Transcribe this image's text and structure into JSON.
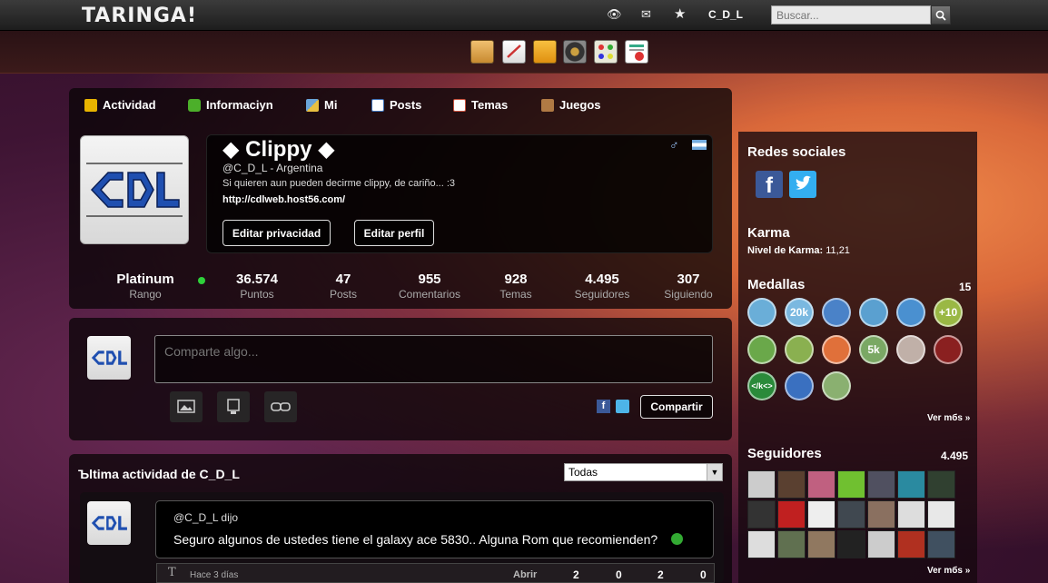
{
  "topbar": {
    "logo": "TARINGA!",
    "username": "C_D_L",
    "search_placeholder": "Buscar..."
  },
  "tabs": [
    {
      "label": "Actividad",
      "icon": "actividad-icon",
      "color": "#e8b400"
    },
    {
      "label": "Informaciyn",
      "icon": "info-icon",
      "color": "#4caf2a"
    },
    {
      "label": "Mi",
      "icon": "mi-icon",
      "color": "#6aa4d8"
    },
    {
      "label": "Posts",
      "icon": "posts-icon",
      "color": "#3b6fb6"
    },
    {
      "label": "Temas",
      "icon": "temas-icon",
      "color": "#c8503c"
    },
    {
      "label": "Juegos",
      "icon": "juegos-icon",
      "color": "#b07a44"
    }
  ],
  "profile": {
    "name": "◆ Clippy ◆",
    "handle": "@C_D_L - Argentina",
    "bio": "Si quieren aun pueden decirme clippy, de cariño... :3",
    "url": "http://cdlweb.host56.com/",
    "edit_privacy": "Editar privacidad",
    "edit_profile": "Editar perfil"
  },
  "stats": [
    {
      "value": "Platinum",
      "label": "Rango"
    },
    {
      "value": "36.574",
      "label": "Puntos"
    },
    {
      "value": "47",
      "label": "Posts"
    },
    {
      "value": "955",
      "label": "Comentarios"
    },
    {
      "value": "928",
      "label": "Temas"
    },
    {
      "value": "4.495",
      "label": "Seguidores"
    },
    {
      "value": "307",
      "label": "Siguiendo"
    }
  ],
  "share": {
    "placeholder": "Comparte algo...",
    "button": "Compartir"
  },
  "activity": {
    "title": "Ъltima actividad de C_D_L",
    "filter": "Todas",
    "post_author": "@C_D_L dijo",
    "post_text": "Seguro algunos de ustedes tiene el galaxy ace 5830.. Alguna Rom que recomienden?",
    "time": "Hace 3 días",
    "open": "Abrir",
    "counts": [
      "2",
      "0",
      "2",
      "0"
    ]
  },
  "sidebar": {
    "social_title": "Redes sociales",
    "karma_title": "Karma",
    "karma_label": "Nivel de Karma:",
    "karma_value": "11,21",
    "medals_title": "Medallas",
    "medals_count": "15",
    "medals_more": "Ver mбs »",
    "followers_title": "Seguidores",
    "followers_count": "4.495",
    "followers_more": "Ver mбs »"
  },
  "medals": [
    {
      "text": "",
      "color": "#6aaed8"
    },
    {
      "text": "20k",
      "color": "#7ab8e0"
    },
    {
      "text": "",
      "color": "#4a82c8"
    },
    {
      "text": "",
      "color": "#5aa0d0"
    },
    {
      "text": "",
      "color": "#4a90d0"
    },
    {
      "text": "+10",
      "color": "#9ab844"
    },
    {
      "text": "",
      "color": "#6aa84a"
    },
    {
      "text": "",
      "color": "#8ab050"
    },
    {
      "text": "",
      "color": "#e0703a"
    },
    {
      "text": "5k",
      "color": "#7aa864"
    },
    {
      "text": "",
      "color": "#c0b0a8"
    },
    {
      "text": "",
      "color": "#8a2020"
    },
    {
      "text": "</k<>",
      "color": "#2a8a3a"
    },
    {
      "text": "",
      "color": "#3a70c0"
    },
    {
      "text": "",
      "color": "#8ab070"
    }
  ]
}
